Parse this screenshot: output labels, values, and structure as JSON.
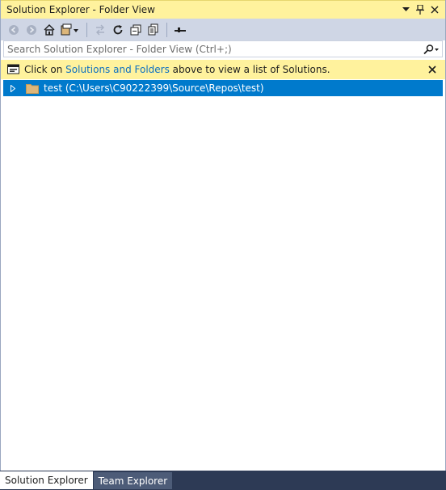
{
  "window": {
    "title": "Solution Explorer - Folder View"
  },
  "titlebar_buttons": [
    {
      "name": "dropdown-icon",
      "glyph": "▾"
    },
    {
      "name": "pin-icon",
      "glyph": "📌"
    },
    {
      "name": "close-icon",
      "glyph": "✕"
    }
  ],
  "toolbar": {
    "items": [
      "back-icon",
      "forward-icon",
      "home-icon",
      "switch-views-icon",
      "pending-changes-icon",
      "sync-icon",
      "refresh-icon",
      "collapse-all-icon",
      "show-all-files-icon",
      "properties-icon"
    ]
  },
  "search": {
    "placeholder": "Search Solution Explorer - Folder View (Ctrl+;)"
  },
  "infobar": {
    "prefix": "Click on ",
    "link": "Solutions and Folders",
    "suffix": " above to view a list of Solutions."
  },
  "tree": {
    "items": [
      {
        "label": "test (C:\\Users\\C90222399\\Source\\Repos\\test)"
      }
    ]
  },
  "tabs": [
    {
      "label": "Solution Explorer",
      "active": true
    },
    {
      "label": "Team Explorer",
      "active": false
    }
  ],
  "colors": {
    "titlebar": "#fff29d",
    "selection": "#007acc",
    "link": "#0e70c0",
    "tab_strip": "#2d3a55"
  }
}
